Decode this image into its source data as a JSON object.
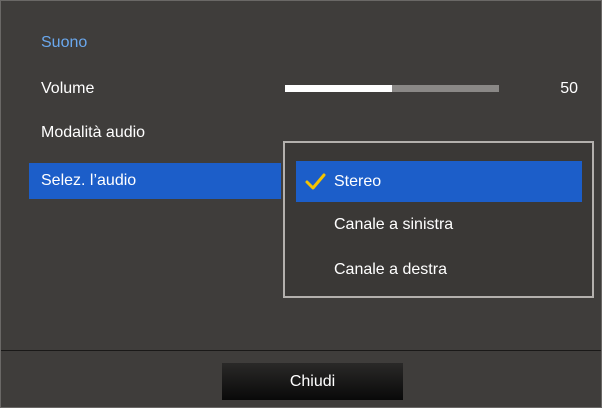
{
  "menu": {
    "title": "Suono",
    "volume_label": "Volume",
    "volume_value": "50",
    "volume_level": 0.5,
    "mode_label": "Modalità audio",
    "select_label": "Selez. l’audio"
  },
  "dropdown": {
    "options": [
      {
        "label": "Stereo",
        "selected": true,
        "icon": "checkmark-icon"
      },
      {
        "label": "Canale a sinistra",
        "selected": false
      },
      {
        "label": "Canale a destra",
        "selected": false
      }
    ]
  },
  "footer": {
    "close_label": "Chiudi"
  },
  "colors": {
    "background": "#3f3d3b",
    "accent": "#1c5ec9",
    "title": "#6aa8ee",
    "checkmark": "#f5c400"
  }
}
